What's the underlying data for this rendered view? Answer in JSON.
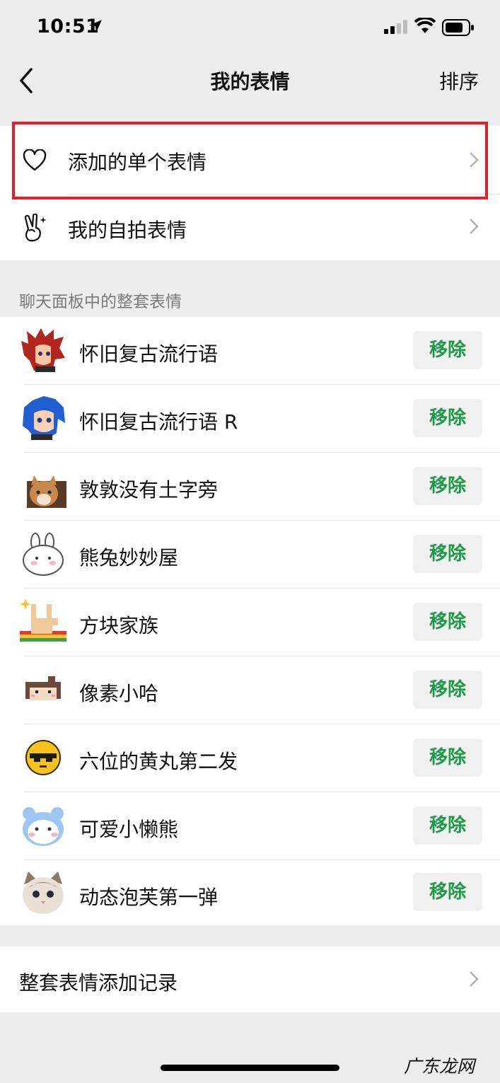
{
  "status": {
    "time": "10:51"
  },
  "nav": {
    "title": "我的表情",
    "sort": "排序"
  },
  "top_items": [
    {
      "label": "添加的单个表情",
      "icon": "heart-icon"
    },
    {
      "label": "我的自拍表情",
      "icon": "peace-hand-icon"
    }
  ],
  "section_header": "聊天面板中的整套表情",
  "remove_label": "移除",
  "packs": [
    {
      "name": "怀旧复古流行语",
      "icon": "anime-red-hair-icon"
    },
    {
      "name": "怀旧复古流行语 R",
      "icon": "anime-blue-hair-icon"
    },
    {
      "name": "敦敦没有土字旁",
      "icon": "cat-photo-icon"
    },
    {
      "name": "熊兔妙妙屋",
      "icon": "bunny-icon"
    },
    {
      "name": "方块家族",
      "icon": "pixel-hand-icon"
    },
    {
      "name": "像素小哈",
      "icon": "pixel-girl-icon"
    },
    {
      "name": "六位的黄丸第二发",
      "icon": "yellow-ball-icon"
    },
    {
      "name": "可爱小懒熊",
      "icon": "blue-bear-icon"
    },
    {
      "name": "动态泡芙第一弹",
      "icon": "kitten-icon"
    }
  ],
  "history": {
    "label": "整套表情添加记录"
  },
  "watermark": "广东龙网"
}
